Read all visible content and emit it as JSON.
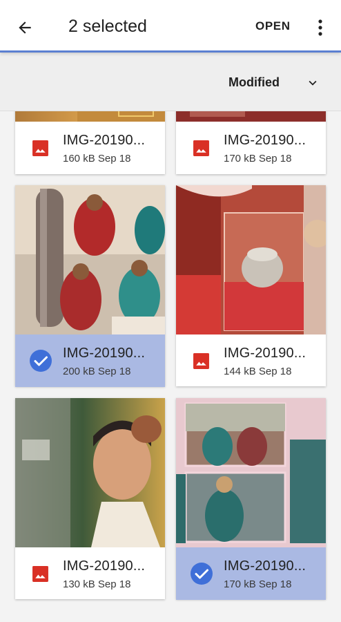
{
  "appbar": {
    "title": "2 selected",
    "open_label": "OPEN",
    "back_icon": "arrow-back-icon",
    "more_icon": "more-vert-icon"
  },
  "sort": {
    "label": "Modified",
    "icon": "chevron-down-icon"
  },
  "colors": {
    "accent": "#5b7fd1",
    "selected_bg": "#aab9e3",
    "check": "#3f6fd8",
    "image_icon": "#d93025"
  },
  "files": [
    {
      "name": "IMG-20190...",
      "size": "160 kB",
      "date": "Sep 18",
      "selected": false
    },
    {
      "name": "IMG-20190...",
      "size": "170 kB",
      "date": "Sep 18",
      "selected": false
    },
    {
      "name": "IMG-20190...",
      "size": "200 kB",
      "date": "Sep 18",
      "selected": true
    },
    {
      "name": "IMG-20190...",
      "size": "144 kB",
      "date": "Sep 18",
      "selected": false
    },
    {
      "name": "IMG-20190...",
      "size": "130 kB",
      "date": "Sep 18",
      "selected": false
    },
    {
      "name": "IMG-20190...",
      "size": "170 kB",
      "date": "Sep 18",
      "selected": true
    }
  ]
}
